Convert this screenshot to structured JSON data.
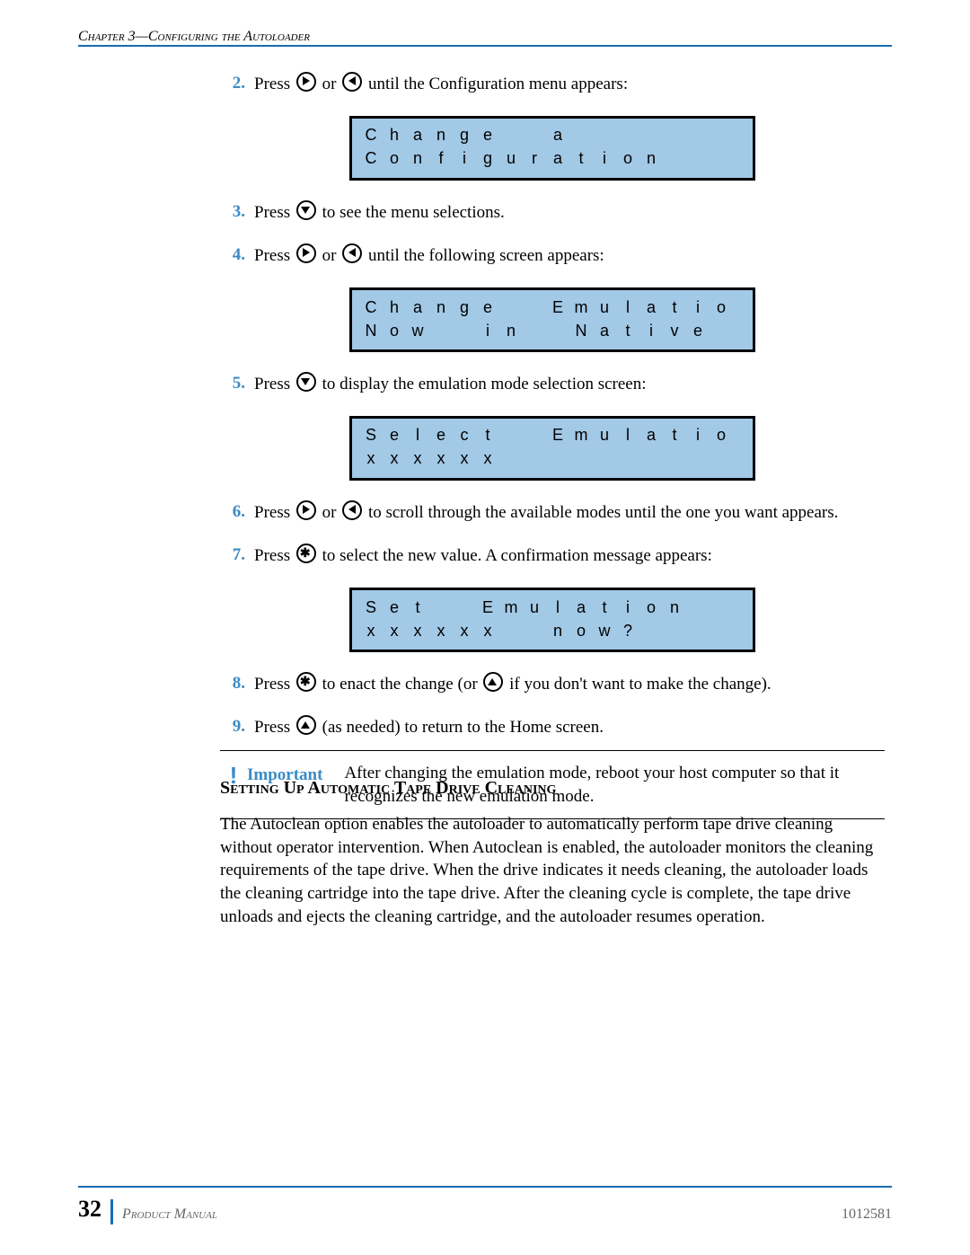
{
  "header": "Chapter 3—Configuring the Autoloader",
  "steps": {
    "s2": {
      "num": "2.",
      "before": "Press ",
      "mid": " or ",
      "after": " until the Configuration menu appears:"
    },
    "s3": {
      "num": "3.",
      "before": "Press ",
      "after": " to see the menu selections."
    },
    "s4": {
      "num": "4.",
      "before": "Press ",
      "mid": " or ",
      "after": " until the following screen appears:"
    },
    "s5": {
      "num": "5.",
      "before": "Press ",
      "after": " to display the emulation mode selection screen:"
    },
    "s6": {
      "num": "6.",
      "before": "Press ",
      "mid": " or ",
      "after": " to scroll through the available modes until the one you want appears."
    },
    "s7": {
      "num": "7.",
      "before": "Press ",
      "after": " to select the new value. A confirmation message appears:"
    },
    "s8": {
      "num": "8.",
      "before": "Press ",
      "mid": " to enact the change (or ",
      "after": " if you don't want to make the change)."
    },
    "s9": {
      "num": "9.",
      "before": "Press ",
      "after": " (as needed) to return to the Home screen."
    }
  },
  "lcds": {
    "l1": {
      "r1": "Change  a",
      "r2": "Configuration"
    },
    "l2": {
      "r1": "Change  Emulation",
      "r2": "Now  in  Native"
    },
    "l3": {
      "r1": "Select  Emulation",
      "r2": "xxxxxx"
    },
    "l4": {
      "r1": "Set  Emulation  to",
      "r2": "xxxxxx  now?"
    }
  },
  "important": {
    "label": "Important",
    "text": "After changing the emulation mode, reboot your host computer so that it recognizes the new emulation mode."
  },
  "section": {
    "heading": "Setting Up Automatic Tape Drive Cleaning",
    "para": "The Autoclean option enables the autoloader to automatically perform tape drive cleaning without operator intervention. When Autoclean is enabled, the autoloader monitors the cleaning requirements of the tape drive. When the drive indicates it needs cleaning, the autoloader loads the cleaning cartridge into the tape drive. After the cleaning cycle is complete, the tape drive unloads and ejects the cleaning cartridge, and the autoloader resumes operation."
  },
  "footer": {
    "page": "32",
    "left": "Product Manual",
    "right": "1012581"
  }
}
